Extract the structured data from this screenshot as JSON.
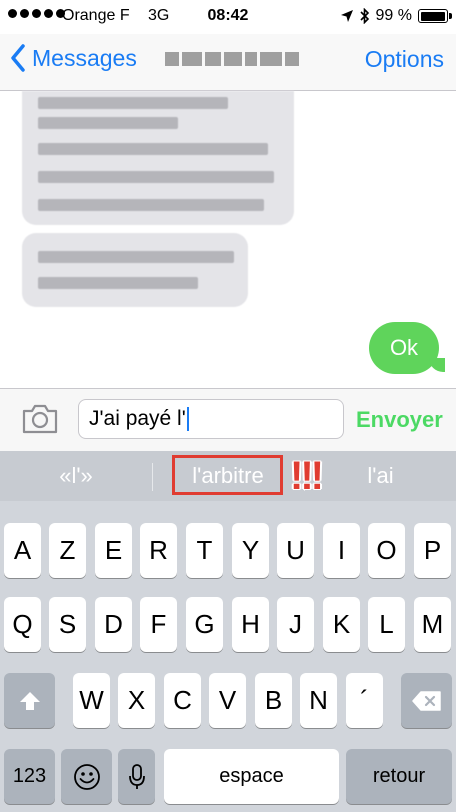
{
  "status": {
    "carrier": "Orange F",
    "network": "3G",
    "time": "08:42",
    "battery": "99 %",
    "battery_level": 0.99
  },
  "nav": {
    "back_label": "Messages",
    "options_label": "Options"
  },
  "messages": {
    "sent_text": "Ok"
  },
  "input": {
    "value": "J'ai payé l'",
    "send_label": "Envoyer"
  },
  "suggestions": {
    "left": "«l'»",
    "center": "l'arbitre",
    "right": "l'ai",
    "annotation": "!!!"
  },
  "keyboard": {
    "row1": [
      "A",
      "Z",
      "E",
      "R",
      "T",
      "Y",
      "U",
      "I",
      "O",
      "P"
    ],
    "row2": [
      "Q",
      "S",
      "D",
      "F",
      "G",
      "H",
      "J",
      "K",
      "L",
      "M"
    ],
    "row3": [
      "W",
      "X",
      "C",
      "V",
      "B",
      "N",
      "´"
    ],
    "numbers_label": "123",
    "space_label": "espace",
    "return_label": "retour"
  },
  "colors": {
    "ios_blue": "#1a7cf4",
    "send_green": "#4cd964",
    "bubble_green": "#5fd45b",
    "annotation_red": "#e03c31"
  }
}
